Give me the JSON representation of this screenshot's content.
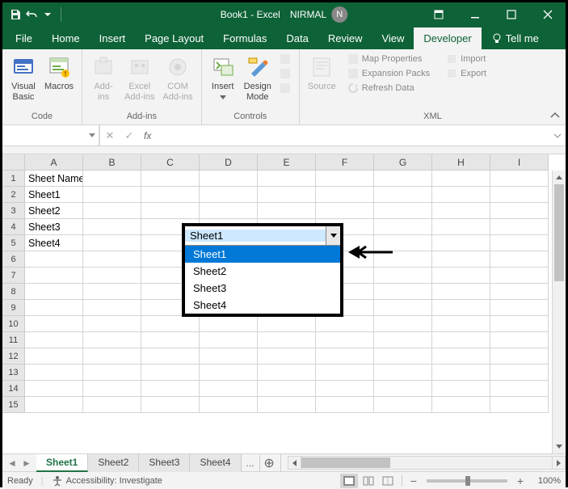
{
  "titlebar": {
    "title": "Book1 - Excel",
    "user_name": "NIRMAL",
    "user_initial": "N"
  },
  "tabs": {
    "file": "File",
    "home": "Home",
    "insert": "Insert",
    "page_layout": "Page Layout",
    "formulas": "Formulas",
    "data": "Data",
    "review": "Review",
    "view": "View",
    "developer": "Developer",
    "tell_me": "Tell me"
  },
  "ribbon": {
    "code": {
      "visual_basic": "Visual\nBasic",
      "macros": "Macros",
      "label": "Code"
    },
    "addins": {
      "addins": "Add-\nins",
      "excel_addins": "Excel\nAdd-ins",
      "com_addins": "COM\nAdd-ins",
      "label": "Add-ins"
    },
    "controls": {
      "insert": "Insert",
      "design_mode": "Design\nMode",
      "label": "Controls"
    },
    "xml": {
      "source": "Source",
      "map_properties": "Map Properties",
      "expansion_packs": "Expansion Packs",
      "refresh_data": "Refresh Data",
      "import": "Import",
      "export": "Export",
      "label": "XML"
    }
  },
  "formula_bar": {
    "name_box": "",
    "fx": "fx",
    "formula": ""
  },
  "columns": [
    "A",
    "B",
    "C",
    "D",
    "E",
    "F",
    "G",
    "H",
    "I"
  ],
  "rows": [
    "1",
    "2",
    "3",
    "4",
    "5",
    "6",
    "7",
    "8",
    "9",
    "10",
    "11",
    "12",
    "13",
    "14",
    "15"
  ],
  "cells": {
    "A1": "Sheet Names",
    "A2": "Sheet1",
    "A3": "Sheet2",
    "A4": "Sheet3",
    "A5": "Sheet4"
  },
  "combo": {
    "value": "Sheet1",
    "options": [
      "Sheet1",
      "Sheet2",
      "Sheet3",
      "Sheet4"
    ],
    "highlighted": "Sheet1"
  },
  "sheets": {
    "tabs": [
      "Sheet1",
      "Sheet2",
      "Sheet3",
      "Sheet4"
    ],
    "active": "Sheet1",
    "more": "..."
  },
  "status": {
    "ready": "Ready",
    "accessibility": "Accessibility: Investigate",
    "zoom": "100%"
  }
}
